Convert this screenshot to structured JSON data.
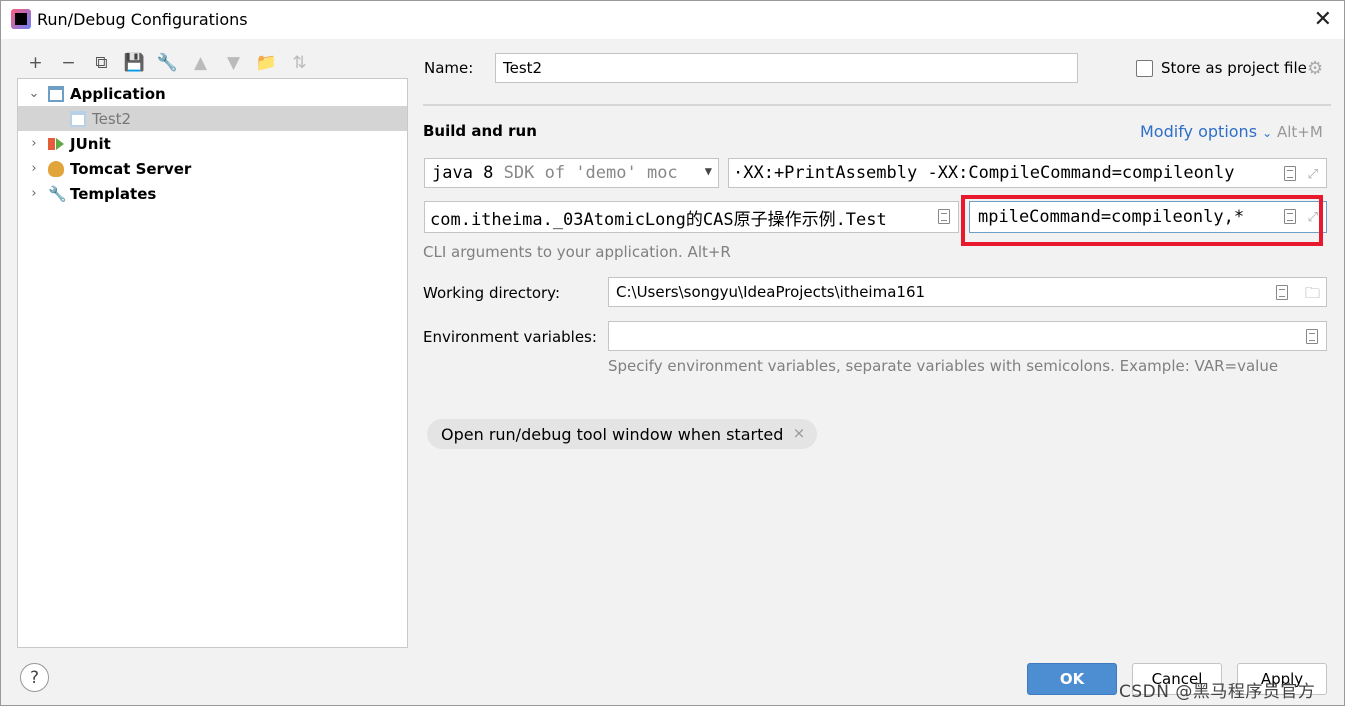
{
  "window": {
    "title": "Run/Debug Configurations"
  },
  "toolbar": {
    "items": [
      {
        "name": "add",
        "glyph": "+"
      },
      {
        "name": "remove",
        "glyph": "−"
      },
      {
        "name": "copy",
        "glyph": "⧉"
      },
      {
        "name": "save",
        "glyph": "💾"
      },
      {
        "name": "edit-defaults",
        "glyph": "🔧"
      },
      {
        "name": "move-up",
        "glyph": "▲"
      },
      {
        "name": "move-down",
        "glyph": "▼"
      },
      {
        "name": "new-folder",
        "glyph": "📁"
      },
      {
        "name": "sort",
        "glyph": "⇅"
      }
    ]
  },
  "tree": {
    "application": "Application",
    "test2": "Test2",
    "junit": "JUnit",
    "tomcat": "Tomcat Server",
    "templates": "Templates"
  },
  "form": {
    "name_label": "Name:",
    "name_value": "Test2",
    "store_label": "Store as project file",
    "section_title": "Build and run",
    "modify_options": "Modify options",
    "modify_shortcut": "Alt+M",
    "jre_main": "java 8",
    "jre_dim": "SDK of 'demo' moc",
    "vm_options": "·XX:+PrintAssembly -XX:CompileCommand=compileonly",
    "main_class": "com.itheima._03AtomicLong的CAS原子操作示例.Test",
    "program_args": "mpileCommand=compileonly,*",
    "cli_hint": "CLI arguments to your application. Alt+R",
    "working_dir_label": "Working directory:",
    "working_dir_value": "C:\\Users\\songyu\\IdeaProjects\\itheima161",
    "env_label": "Environment variables:",
    "env_value": "",
    "env_hint": "Specify environment variables, separate variables with semicolons. Example: VAR=value",
    "chip_label": "Open run/debug tool window when started"
  },
  "buttons": {
    "help": "?",
    "ok": "OK",
    "cancel": "Cancel",
    "apply": "Apply"
  },
  "watermark": "CSDN @黑马程序员官方",
  "colors": {
    "accent": "#4c8ed1",
    "highlight_box": "#e8192c",
    "link": "#2f6fc8"
  }
}
